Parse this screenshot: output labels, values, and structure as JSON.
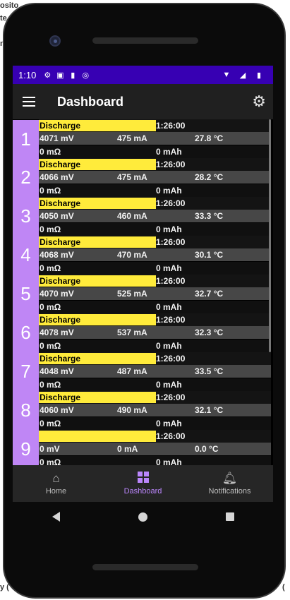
{
  "desktop_fragments": [
    "osito",
    "te",
    "n",
    "y (",
    "("
  ],
  "status": {
    "time": "1:10"
  },
  "appbar": {
    "title": "Dashboard"
  },
  "cells": [
    {
      "num": "1",
      "label": "Discharge",
      "timer": "1:26:00",
      "voltage": "4071 mV",
      "current": "475 mA",
      "temp": "27.8 °C",
      "resistance": "0 mΩ",
      "capacity": "0 mAh"
    },
    {
      "num": "2",
      "label": "Discharge",
      "timer": "1:26:00",
      "voltage": "4066 mV",
      "current": "475 mA",
      "temp": "28.2 °C",
      "resistance": "0 mΩ",
      "capacity": "0 mAh"
    },
    {
      "num": "3",
      "label": "Discharge",
      "timer": "1:26:00",
      "voltage": "4050 mV",
      "current": "460 mA",
      "temp": "33.3 °C",
      "resistance": "0 mΩ",
      "capacity": "0 mAh"
    },
    {
      "num": "4",
      "label": "Discharge",
      "timer": "1:26:00",
      "voltage": "4068 mV",
      "current": "470 mA",
      "temp": "30.1 °C",
      "resistance": "0 mΩ",
      "capacity": "0 mAh"
    },
    {
      "num": "5",
      "label": "Discharge",
      "timer": "1:26:00",
      "voltage": "4070 mV",
      "current": "525 mA",
      "temp": "32.7 °C",
      "resistance": "0 mΩ",
      "capacity": "0 mAh"
    },
    {
      "num": "6",
      "label": "Discharge",
      "timer": "1:26:00",
      "voltage": "4078 mV",
      "current": "537 mA",
      "temp": "32.3 °C",
      "resistance": "0 mΩ",
      "capacity": "0 mAh"
    },
    {
      "num": "7",
      "label": "Discharge",
      "timer": "1:26:00",
      "voltage": "4048 mV",
      "current": "487 mA",
      "temp": "33.5 °C",
      "resistance": "0 mΩ",
      "capacity": "0 mAh"
    },
    {
      "num": "8",
      "label": "Discharge",
      "timer": "1:26:00",
      "voltage": "4060 mV",
      "current": "490 mA",
      "temp": "32.1 °C",
      "resistance": "0 mΩ",
      "capacity": "0 mAh"
    },
    {
      "num": "9",
      "label": "",
      "timer": "1:26:00",
      "voltage": "0 mV",
      "current": "0 mA",
      "temp": "0.0 °C",
      "resistance": "0 mΩ",
      "capacity": "0 mAh"
    }
  ],
  "bottomnav": {
    "home": "Home",
    "dashboard": "Dashboard",
    "notifications": "Notifications"
  },
  "colors": {
    "statusbar": "#3700b3",
    "accent": "#bb86fc",
    "cell_number": "#bf86f5",
    "label_bg": "#ffeb3b"
  }
}
